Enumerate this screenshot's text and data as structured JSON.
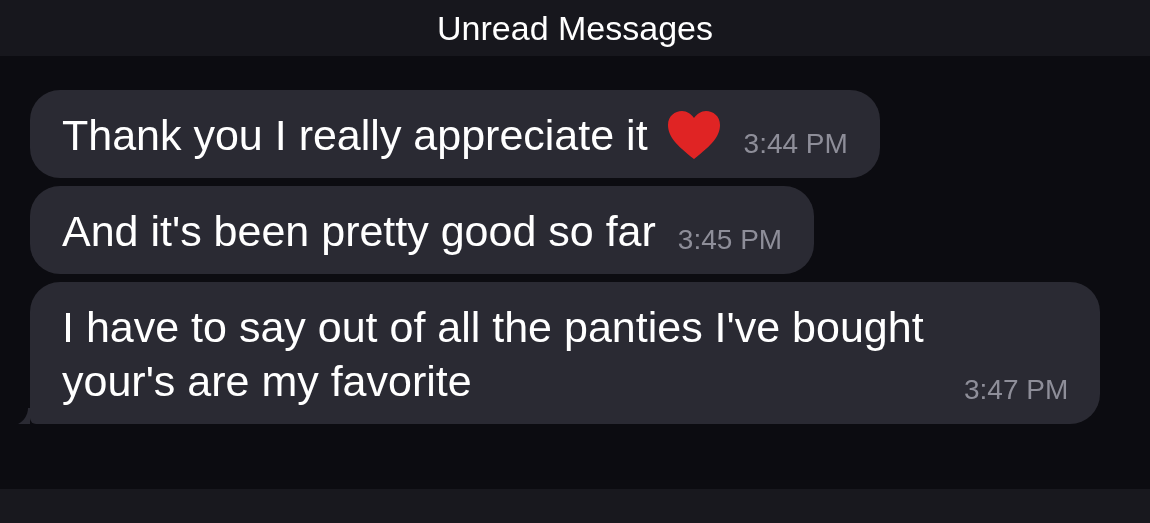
{
  "header": {
    "title": "Unread Messages"
  },
  "messages": [
    {
      "kind": "text-heart",
      "text": "Thank you I really appreciate it",
      "time": "3:44 PM",
      "tail": false
    },
    {
      "kind": "text",
      "text": "And it's been pretty good so far",
      "time": "3:45 PM",
      "tail": false
    },
    {
      "kind": "text",
      "text": "I have to say out of all the panties I've bought your's are my favorite",
      "time": "3:47 PM",
      "tail": true
    }
  ]
}
